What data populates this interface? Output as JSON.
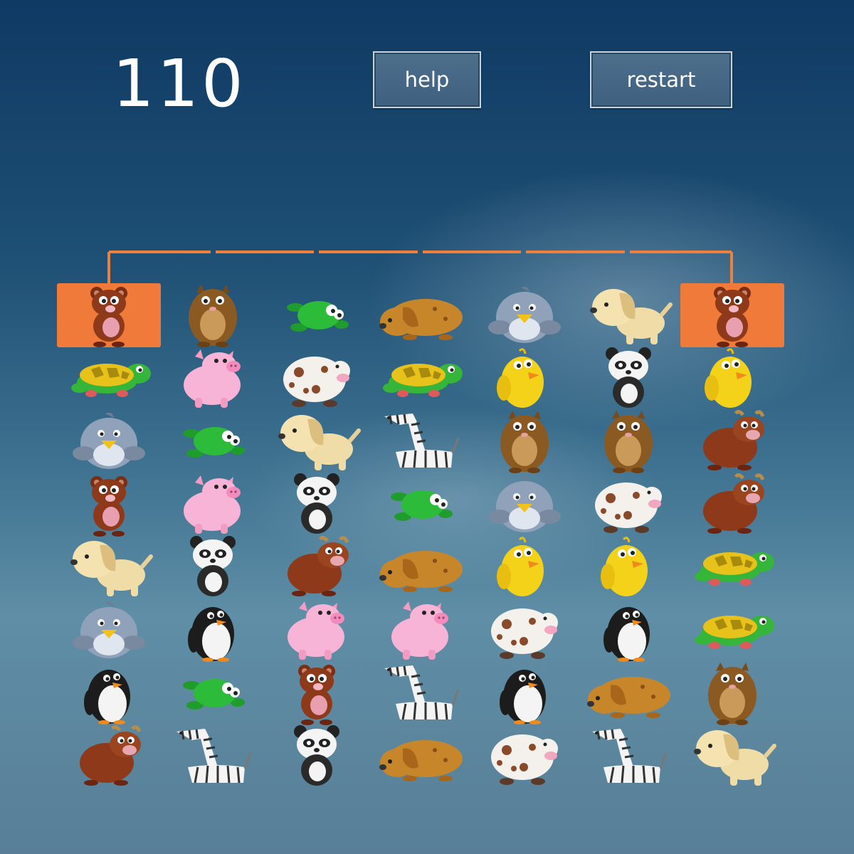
{
  "score": "110",
  "buttons": {
    "help": "help",
    "restart": "restart"
  },
  "colors": {
    "selection": "#f07a3a",
    "path": "#ef7f3a"
  },
  "board": {
    "rows": [
      [
        "bear",
        "hamster",
        "frog",
        "dog-lying",
        "bird",
        "dog",
        "bear"
      ],
      [
        "turtle",
        "pig",
        "cow",
        "turtle",
        "chick",
        "panda",
        "chick"
      ],
      [
        "bird",
        "frog",
        "dog",
        "zebra",
        "hamster",
        "hamster",
        "bull"
      ],
      [
        "bear",
        "pig",
        "panda",
        "frog",
        "bird",
        "cow",
        "bull"
      ],
      [
        "dog",
        "panda",
        "bull",
        "dog-lying",
        "chick",
        "chick",
        "turtle"
      ],
      [
        "bird",
        "penguin",
        "pig",
        "pig",
        "cow",
        "penguin",
        "turtle"
      ],
      [
        "penguin",
        "frog",
        "bear",
        "zebra",
        "penguin",
        "dog-lying",
        "hamster"
      ],
      [
        "bull",
        "zebra",
        "panda",
        "dog-lying",
        "cow",
        "zebra",
        "dog"
      ]
    ],
    "selected": [
      [
        0,
        0
      ],
      [
        0,
        6
      ]
    ],
    "connection_path": {
      "from": [
        0,
        0
      ],
      "to": [
        0,
        6
      ],
      "via": "above-row-0"
    }
  }
}
